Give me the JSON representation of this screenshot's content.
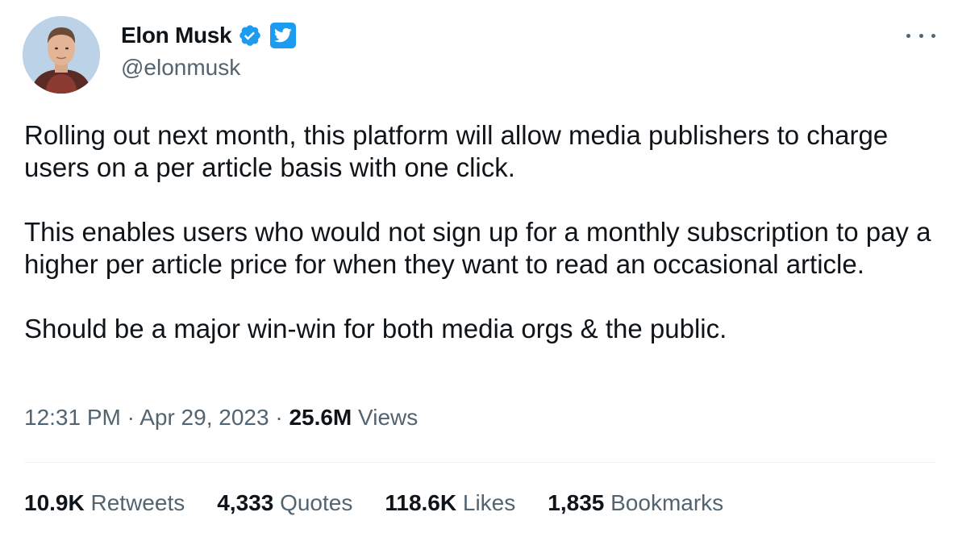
{
  "author": {
    "display_name": "Elon Musk",
    "handle": "@elonmusk",
    "verified": true,
    "verified_icon": "verified-badge-icon",
    "affiliate_icon": "twitter-bird-icon",
    "avatar": "profile-photo"
  },
  "tweet": {
    "paragraphs": [
      "Rolling out next month, this platform will allow media publishers to charge users on a per article basis with one click.",
      "This enables users who would not sign up for a monthly subscription to pay a higher per article price for when they want to read an occasional article.",
      "Should be a major win-win for both media orgs & the public."
    ]
  },
  "meta": {
    "time": "12:31 PM",
    "separator": " · ",
    "date": "Apr 29, 2023",
    "views_count": "25.6M",
    "views_label": "Views"
  },
  "stats": {
    "retweets": {
      "count": "10.9K",
      "label": "Retweets"
    },
    "quotes": {
      "count": "4,333",
      "label": "Quotes"
    },
    "likes": {
      "count": "118.6K",
      "label": "Likes"
    },
    "bookmarks": {
      "count": "1,835",
      "label": "Bookmarks"
    }
  },
  "colors": {
    "text": "#0f1419",
    "secondary": "#536471",
    "accent": "#1d9bf0",
    "divider": "#eff3f4"
  }
}
